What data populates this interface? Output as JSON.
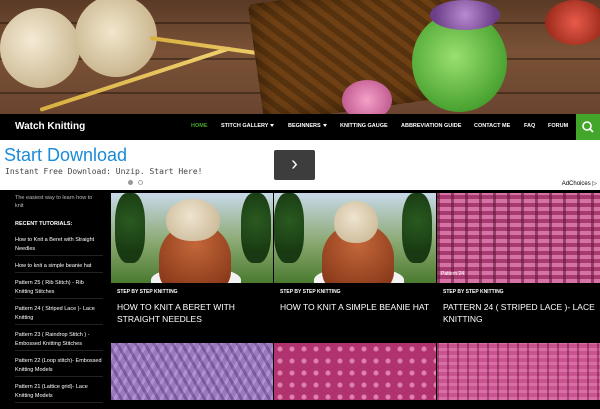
{
  "site": {
    "title": "Watch Knitting",
    "tagline": "The easiest way to learn how to knit"
  },
  "nav": {
    "items": [
      {
        "label": "HOME",
        "active": true,
        "dropdown": false
      },
      {
        "label": "STITCH GALLERY",
        "active": false,
        "dropdown": true
      },
      {
        "label": "BEGINNERS",
        "active": false,
        "dropdown": true
      },
      {
        "label": "KNITTING GAUGE",
        "active": false,
        "dropdown": false
      },
      {
        "label": "ABBREVIATION GUIDE",
        "active": false,
        "dropdown": false
      },
      {
        "label": "CONTACT ME",
        "active": false,
        "dropdown": false
      },
      {
        "label": "FAQ",
        "active": false,
        "dropdown": false
      },
      {
        "label": "FORUM",
        "active": false,
        "dropdown": false
      }
    ],
    "search_icon": "search-icon",
    "accent": "#41a62a"
  },
  "ad": {
    "title": "Start Download",
    "subtitle": "Instant Free Download: Unzip. Start Here!",
    "arrow": "›",
    "choices": "AdChoices",
    "title_color": "#1a8bd8"
  },
  "sidebar": {
    "heading": "RECENT TUTORIALS:",
    "links": [
      "How to Knit a Beret with Straight Needles",
      "How to knit a simple beanie hat",
      "Pattern 25 ( Rib Stitch) - Rib Knitting Stitches",
      "Pattern 24 ( Striped Lace )- Lace Knitting",
      "Pattern 23 ( Raindrop Stitch ) - Embossed Knitting Stitches",
      "Pattern 22 (Loop stitch)- Embossed Knitting Models",
      "Pattern 21 (Lattice grid)- Lace Knitting Models"
    ]
  },
  "cards": [
    {
      "category": "STEP BY STEP KNITTING",
      "title": "HOW TO KNIT A BERET WITH STRAIGHT NEEDLES"
    },
    {
      "category": "STEP BY STEP KNITTING",
      "title": "HOW TO KNIT A SIMPLE BEANIE HAT"
    },
    {
      "category": "STEP BY STEP KNITTING",
      "title": "PATTERN 24 ( STRIPED LACE )- LACE KNITTING",
      "image_label": "Pattern 24"
    }
  ]
}
